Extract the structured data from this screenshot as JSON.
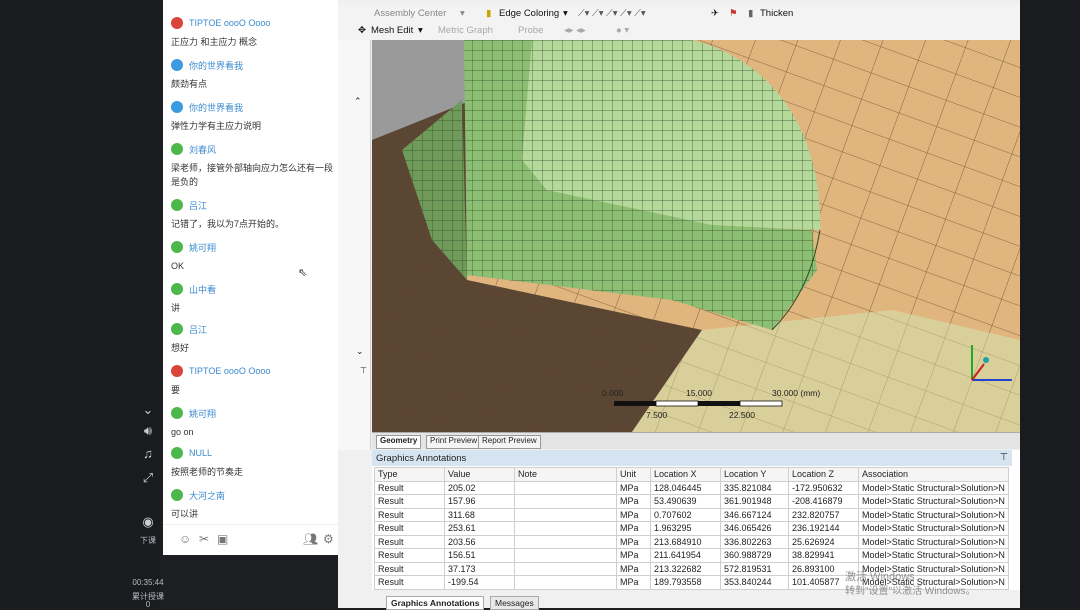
{
  "sidebar": {
    "tool_icons": [
      "chevron-down-icon",
      "volume-icon",
      "music-icon",
      "fullscreen-icon"
    ],
    "download_label": "下课",
    "time": "00:35:44",
    "time_label": "累计授课",
    "time_sub": "0"
  },
  "chat": {
    "messages": [
      {
        "nick": "TIPTOE oooO Oooo",
        "avatar_color": "#d9453b",
        "text": "正应力 和主应力 概念"
      },
      {
        "nick": "你的世界看我",
        "avatar_color": "#3c9ae0",
        "text": "颇劲有点"
      },
      {
        "nick": "你的世界看我",
        "avatar_color": "#3c9ae0",
        "text": "弹性力学有主应力说明"
      },
      {
        "nick": "刘春风",
        "avatar_color": "#4cb84c",
        "text": "梁老师，接管外部轴向应力怎么还有一段是负的"
      },
      {
        "nick": "吕江",
        "avatar_color": "#4cb84c",
        "text": "记错了，我以为7点开始的。"
      },
      {
        "nick": "姚可翔",
        "avatar_color": "#4cb84c",
        "text": "OK"
      },
      {
        "nick": "山中看",
        "avatar_color": "#4cb84c",
        "text": "讲"
      },
      {
        "nick": "吕江",
        "avatar_color": "#4cb84c",
        "text": "想好"
      },
      {
        "nick": "TIPTOE oooO Oooo",
        "avatar_color": "#d9453b",
        "text": "要"
      },
      {
        "nick": "姚可翔",
        "avatar_color": "#4cb84c",
        "text": "go on"
      },
      {
        "nick": "NULL",
        "avatar_color": "#4cb84c",
        "text": "按照老师的节奏走"
      },
      {
        "nick": "大河之南",
        "avatar_color": "#4cb84c",
        "text": "可以讲"
      }
    ]
  },
  "toolbar": {
    "assembly_center": "Assembly Center",
    "edge_coloring": "Edge Coloring",
    "thicken": "Thicken",
    "mesh_edit": "Mesh Edit",
    "metric_graph": "Metric Graph",
    "probe": "Probe"
  },
  "scale_bar": {
    "top_labels": [
      "0.000",
      "15.000",
      "30.000 (mm)"
    ],
    "bottom_labels": [
      "7.500",
      "22.500"
    ]
  },
  "view_tabs": [
    "Geometry",
    "Print Preview",
    "Report Preview"
  ],
  "annotations": {
    "title": "Graphics Annotations",
    "pin": "ꟷ",
    "columns": [
      "Type",
      "Value",
      "Note",
      "Unit",
      "Location X",
      "Location Y",
      "Location Z",
      "Association"
    ],
    "rows": [
      [
        "Result",
        "205.02",
        "",
        "MPa",
        "128.046445",
        "335.821084",
        "-172.950632",
        "Model>Static Structural>Solution>N"
      ],
      [
        "Result",
        "157.96",
        "",
        "MPa",
        "53.490639",
        "361.901948",
        "-208.416879",
        "Model>Static Structural>Solution>N"
      ],
      [
        "Result",
        "311.68",
        "",
        "MPa",
        "0.707602",
        "346.667124",
        "232.820757",
        "Model>Static Structural>Solution>N"
      ],
      [
        "Result",
        "253.61",
        "",
        "MPa",
        "1.963295",
        "346.065426",
        "236.192144",
        "Model>Static Structural>Solution>N"
      ],
      [
        "Result",
        "203.56",
        "",
        "MPa",
        "213.684910",
        "336.802263",
        "25.626924",
        "Model>Static Structural>Solution>N"
      ],
      [
        "Result",
        "156.51",
        "",
        "MPa",
        "211.641954",
        "360.988729",
        "38.829941",
        "Model>Static Structural>Solution>N"
      ],
      [
        "Result",
        "37.173",
        "",
        "MPa",
        "213.322682",
        "572.819531",
        "26.893100",
        "Model>Static Structural>Solution>N"
      ],
      [
        "Result",
        "-199.54",
        "",
        "MPa",
        "189.793558",
        "353.840244",
        "101.405877",
        "Model>Static Structural>Solution>N"
      ]
    ]
  },
  "bottom_tabs": [
    "Graphics Annotations",
    "Messages"
  ],
  "watermark": {
    "line1": "激活 Windows",
    "line2": "转到\"设置\"以激活 Windows。"
  },
  "colors": {
    "mesh_green": "#9fcf86",
    "surface_tan": "#e2b77d",
    "shadow_brown": "#5a4632"
  }
}
